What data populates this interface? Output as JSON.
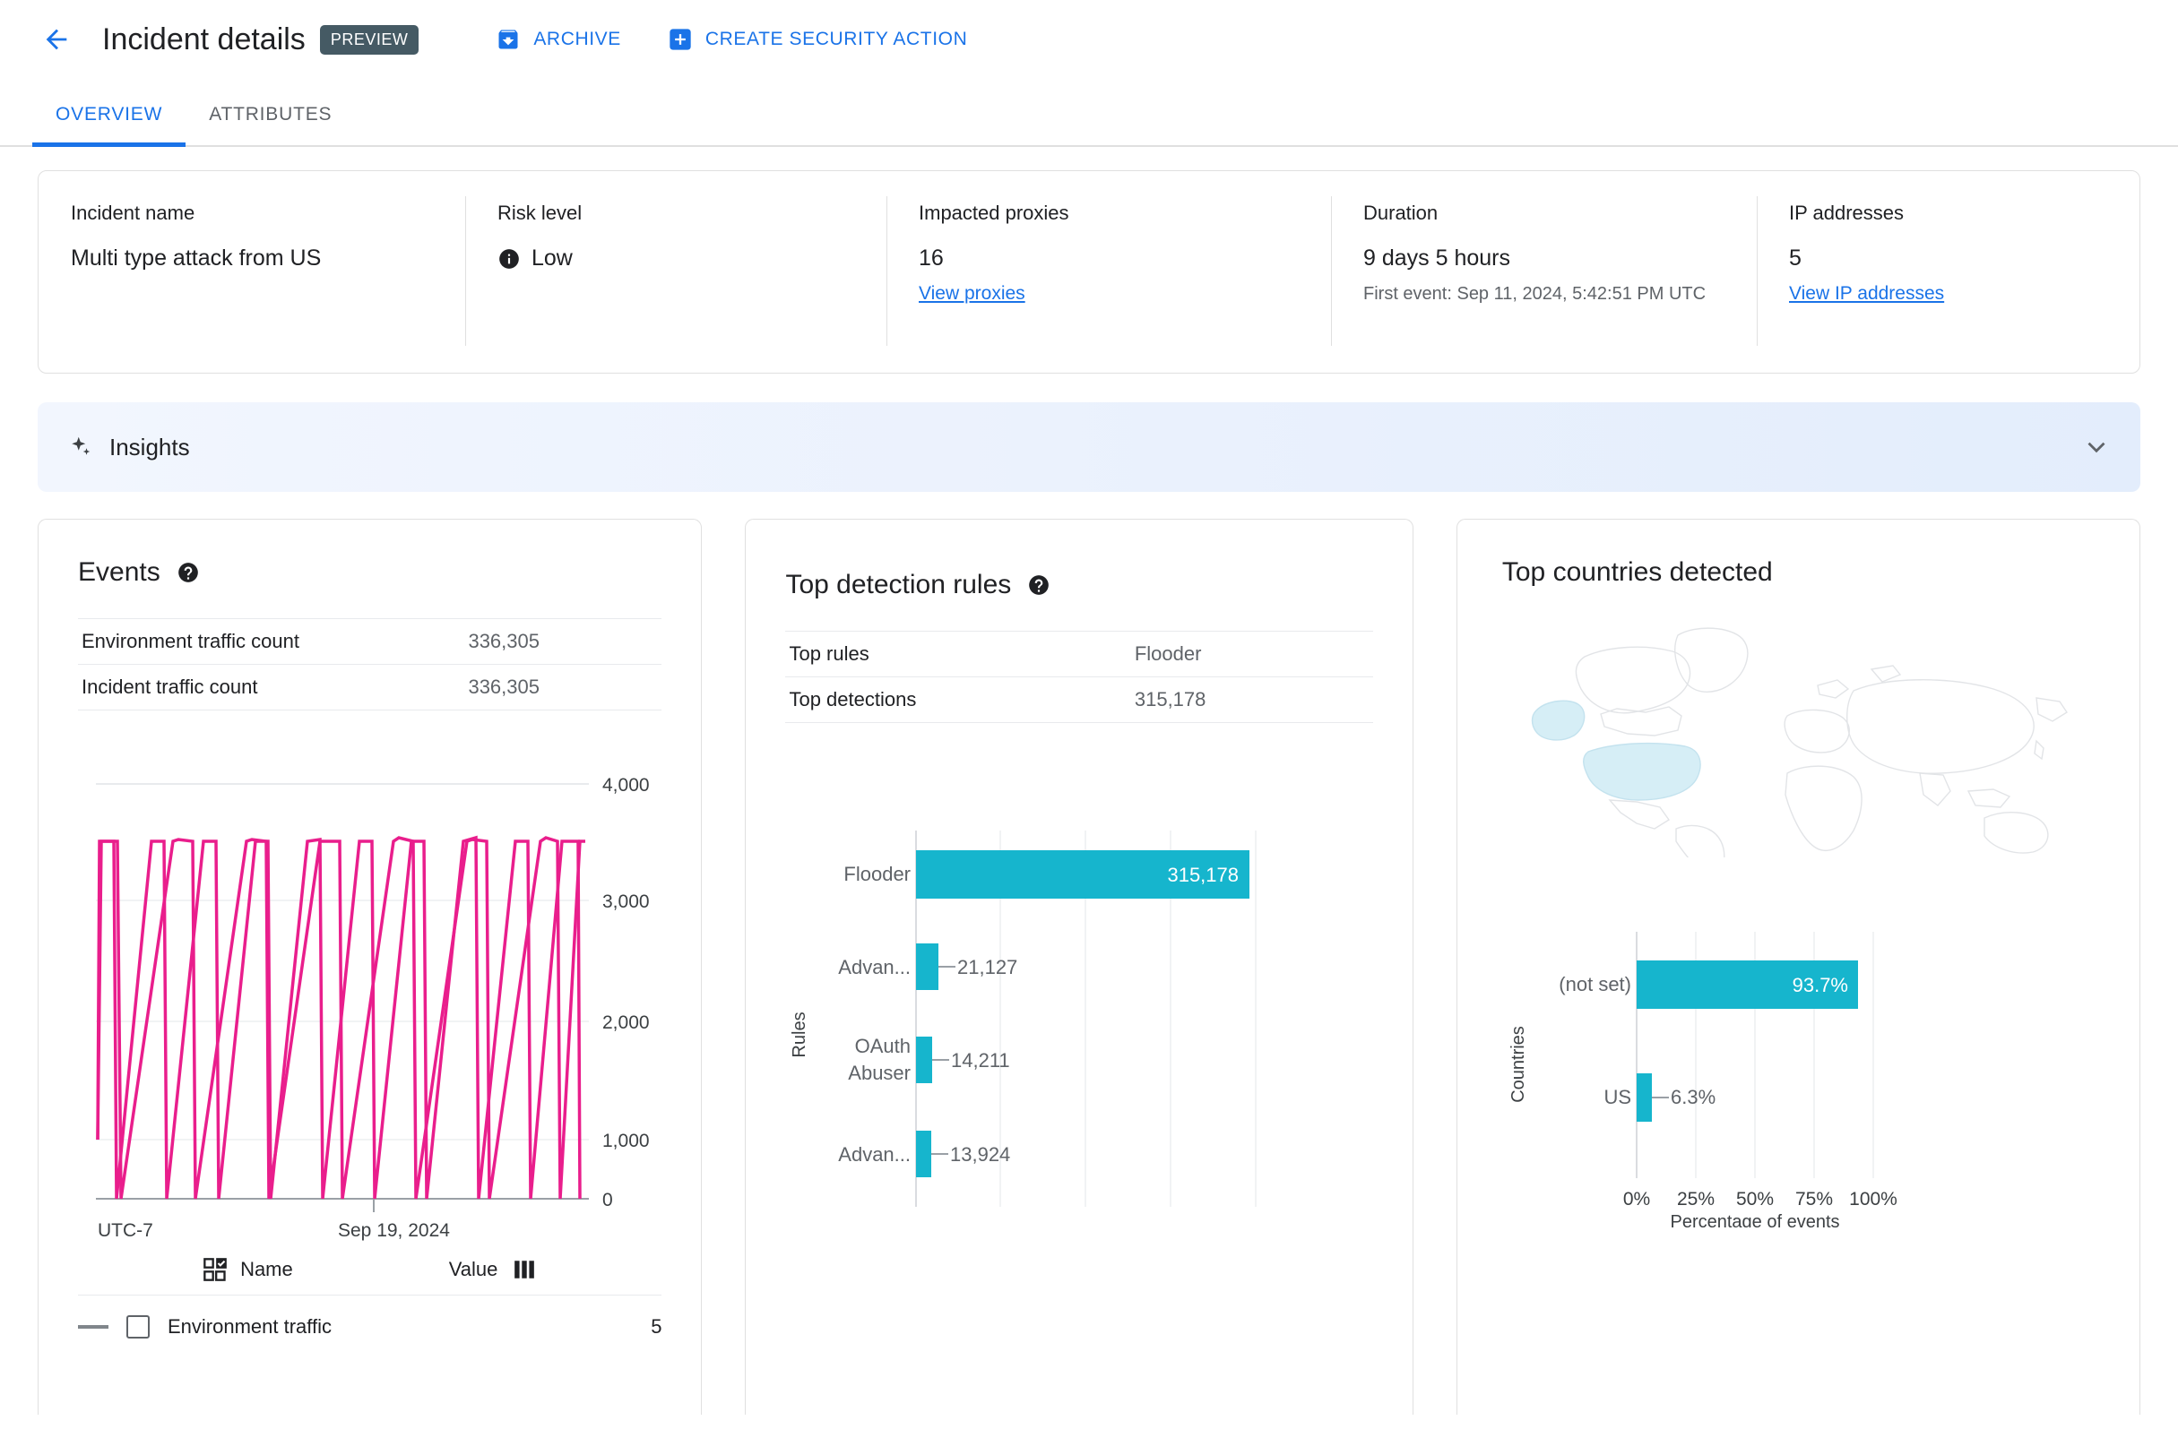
{
  "header": {
    "back_icon": "arrow-left-icon",
    "title": "Incident details",
    "preview_badge": "PREVIEW",
    "actions": [
      {
        "label": "ARCHIVE",
        "icon": "archive-icon"
      },
      {
        "label": "CREATE SECURITY ACTION",
        "icon": "plus-box-icon"
      }
    ]
  },
  "tabs": [
    {
      "label": "OVERVIEW",
      "active": true
    },
    {
      "label": "ATTRIBUTES",
      "active": false
    }
  ],
  "summary": {
    "incident_name_label": "Incident name",
    "incident_name_value": "Multi type attack from US",
    "risk_level_label": "Risk level",
    "risk_level_value": "Low",
    "risk_level_icon": "info-icon",
    "impacted_proxies_label": "Impacted proxies",
    "impacted_proxies_value": "16",
    "impacted_proxies_link": "View proxies",
    "duration_label": "Duration",
    "duration_value": "9 days 5 hours",
    "duration_sub": "First event: Sep 11, 2024, 5:42:51 PM UTC",
    "ip_addresses_label": "IP addresses",
    "ip_addresses_value": "5",
    "ip_addresses_link": "View IP addresses"
  },
  "insights": {
    "title": "Insights",
    "sparkle_icon": "sparkle-icon",
    "chevron_icon": "chevron-down-icon"
  },
  "events_card": {
    "title": "Events",
    "help_icon": "help-icon",
    "rows": [
      {
        "key": "Environment traffic count",
        "value": "336,305"
      },
      {
        "key": "Incident traffic count",
        "value": "336,305"
      }
    ],
    "legend_header": {
      "select_icon": "select-all-icon",
      "name": "Name",
      "value": "Value",
      "columns_icon": "columns-icon"
    },
    "legend_rows": [
      {
        "name": "Environment traffic",
        "value": "5"
      }
    ]
  },
  "rules_card": {
    "title": "Top detection rules",
    "help_icon": "help-icon",
    "rows": [
      {
        "key": "Top rules",
        "value": "Flooder"
      },
      {
        "key": "Top detections",
        "value": "315,178"
      }
    ]
  },
  "countries_card": {
    "title": "Top countries detected",
    "map_icon": "world-map",
    "highlighted_regions": [
      "United States",
      "Alaska"
    ]
  },
  "chart_data": [
    {
      "type": "line",
      "id": "events-timeseries",
      "title": "Events",
      "xlabel": "UTC-7",
      "ylabel": "",
      "ylim": [
        0,
        4000
      ],
      "yticks": [
        0,
        1000,
        2000,
        3000,
        4000
      ],
      "ytick_labels": [
        "0",
        "1,000",
        "2,000",
        "3,000",
        "4,000"
      ],
      "xtick_labels": [
        "UTC-7",
        "Sep 19, 2024"
      ],
      "grid": true,
      "series": [
        {
          "name": "Environment traffic",
          "color": "#e91e8c",
          "pattern": "sawtooth",
          "peak": 3500,
          "trough": 0,
          "cycles": 10,
          "values": [
            1000,
            3500,
            3500,
            0,
            3500,
            3500,
            0,
            3500,
            3500,
            0,
            3500,
            3500,
            0,
            3500,
            3500,
            0,
            3500,
            3500,
            0,
            3500,
            3500,
            0,
            3500,
            3500,
            0,
            3500,
            3500,
            0,
            3500,
            3500,
            0
          ]
        }
      ]
    },
    {
      "type": "bar",
      "id": "top-detection-rules",
      "orientation": "horizontal",
      "title": "Top detection rules",
      "xlabel": "",
      "ylabel": "Rules",
      "categories": [
        "Flooder",
        "Advan...",
        "OAuth Abuser",
        "Advan..."
      ],
      "values": [
        315178,
        21127,
        14211,
        13924
      ],
      "value_labels": [
        "315,178",
        "21,127",
        "14,211",
        "13,924"
      ],
      "xlim": [
        0,
        370000
      ],
      "gridlines": 5,
      "bar_color": "#16b5cd"
    },
    {
      "type": "bar",
      "id": "top-countries-detected",
      "orientation": "horizontal",
      "title": "Top countries detected",
      "xlabel": "Percentage of events",
      "ylabel": "Countries",
      "categories": [
        "(not set)",
        "US"
      ],
      "values": [
        93.7,
        6.3
      ],
      "value_labels": [
        "93.7%",
        "6.3%"
      ],
      "xlim": [
        0,
        110
      ],
      "xticks": [
        0,
        25,
        50,
        75,
        100
      ],
      "xtick_labels": [
        "0%",
        "25%",
        "50%",
        "75%",
        "100%"
      ],
      "bar_color": "#16b5cd"
    }
  ]
}
